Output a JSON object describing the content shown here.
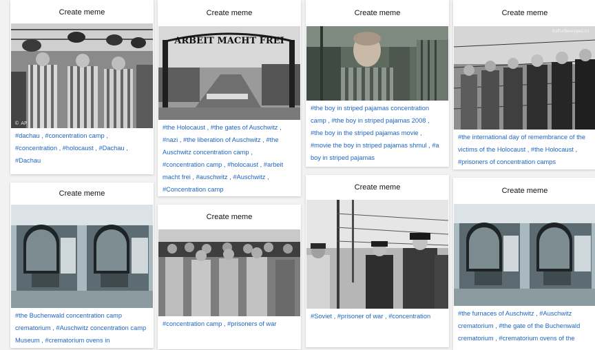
{
  "cards": [
    {
      "title": "Create meme",
      "photo": "liberated-prisoners-cheering-photo",
      "watermark": "© AP",
      "tags": [
        "#dachau",
        "#concentration camp",
        "#concentration",
        "#holocaust",
        "#Dachau",
        "#Dachau"
      ]
    },
    {
      "title": "Create meme",
      "photo": "arbeit-macht-frei-gate-photo",
      "gate_sign": "ARBEIT MACHT FREI",
      "tags": [
        "#the Holocaust",
        "#the gates of Auschwitz",
        "#nazi",
        "#the liberation of Auschwitz",
        "#the Auschwitz concentration camp",
        "#concentration camp",
        "#holocaust",
        "#arbeit macht frei",
        "#auschwitz",
        "#Auschwitz",
        "#Concentration camp"
      ]
    },
    {
      "title": "Create meme",
      "photo": "boy-in-striped-pajamas-photo",
      "tags": [
        "#the boy in striped pajamas concentration camp",
        "#the boy in striped pajamas 2008",
        "#the boy in the striped pajamas movie",
        "#movie the boy in striped pajamas shmul",
        "#a boy in striped pajamas"
      ]
    },
    {
      "title": "Create meme",
      "photo": "prisoners-behind-fence-photo",
      "watermark_top": "KulturNewsgeo.ru",
      "tags": [
        "#the international day of remembrance of the victims of the Holocaust",
        "#the Holocaust",
        "#prisoners of concentration camps"
      ]
    },
    {
      "title": "Create meme",
      "photo": "crematorium-ovens-photo",
      "tags": [
        "#the Buchenwald concentration camp crematorium",
        "#Auschwitz concentration camp Museum",
        "#crematorium ovens in"
      ]
    },
    {
      "title": "Create meme",
      "photo": "emaciated-prisoners-group-photo",
      "tags": [
        "#concentration camp",
        "#prisoners of war"
      ]
    },
    {
      "title": "Create meme",
      "photo": "soldiers-and-prisoner-photo",
      "tags": [
        "#Soviet",
        "#prisoner of war",
        "#concentration"
      ]
    },
    {
      "title": "Create meme",
      "photo": "crematorium-ovens-photo-2",
      "tags": [
        "#the furnaces of Auschwitz",
        "#Auschwitz crematorium",
        "#the gate of the Buchenwald crematorium",
        "#crematorium ovens of the"
      ]
    }
  ]
}
